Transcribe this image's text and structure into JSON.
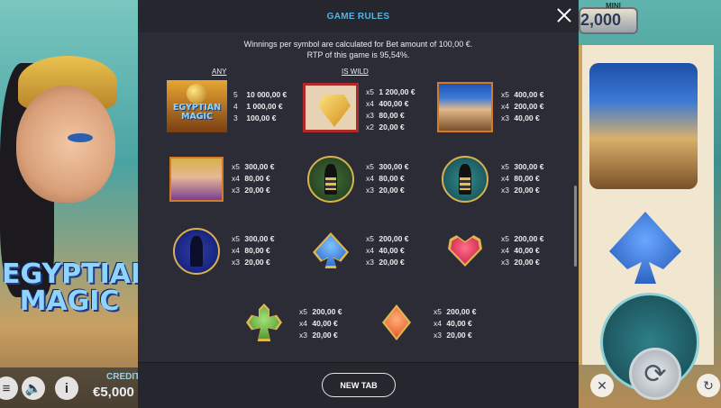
{
  "modal": {
    "title": "GAME RULES",
    "intro_line1": "Winnings per symbol are calculated for Bet amount of 100,00 €.",
    "intro_line2": "RTP of this game is 95,54%.",
    "col_any": "ANY",
    "col_wild": "IS WILD",
    "footer_button": "NEW TAB"
  },
  "symbols": [
    {
      "name": "egyptian-magic-logo",
      "label": "EGYPTIAN MAGIC",
      "pays": [
        {
          "m": "5",
          "v": "10 000,00 €"
        },
        {
          "m": "4",
          "v": "1 000,00 €"
        },
        {
          "m": "3",
          "v": "100,00 €"
        }
      ]
    },
    {
      "name": "wild-gem",
      "pays": [
        {
          "m": "x5",
          "v": "1 200,00 €"
        },
        {
          "m": "x4",
          "v": "400,00 €"
        },
        {
          "m": "x3",
          "v": "80,00 €"
        },
        {
          "m": "x2",
          "v": "20,00 €"
        }
      ]
    },
    {
      "name": "pharaoh",
      "pays": [
        {
          "m": "x5",
          "v": "400,00 €"
        },
        {
          "m": "x4",
          "v": "200,00 €"
        },
        {
          "m": "x3",
          "v": "40,00 €"
        }
      ]
    },
    {
      "name": "cleopatra",
      "pays": [
        {
          "m": "x5",
          "v": "300,00 €"
        },
        {
          "m": "x4",
          "v": "80,00 €"
        },
        {
          "m": "x3",
          "v": "20,00 €"
        }
      ]
    },
    {
      "name": "anubis-green",
      "pays": [
        {
          "m": "x5",
          "v": "300,00 €"
        },
        {
          "m": "x4",
          "v": "80,00 €"
        },
        {
          "m": "x3",
          "v": "20,00 €"
        }
      ]
    },
    {
      "name": "anubis-teal",
      "pays": [
        {
          "m": "x5",
          "v": "300,00 €"
        },
        {
          "m": "x4",
          "v": "80,00 €"
        },
        {
          "m": "x3",
          "v": "20,00 €"
        }
      ]
    },
    {
      "name": "bastet",
      "pays": [
        {
          "m": "x5",
          "v": "300,00 €"
        },
        {
          "m": "x4",
          "v": "80,00 €"
        },
        {
          "m": "x3",
          "v": "20,00 €"
        }
      ]
    },
    {
      "name": "spade",
      "pays": [
        {
          "m": "x5",
          "v": "200,00 €"
        },
        {
          "m": "x4",
          "v": "40,00 €"
        },
        {
          "m": "x3",
          "v": "20,00 €"
        }
      ]
    },
    {
      "name": "heart",
      "pays": [
        {
          "m": "x5",
          "v": "200,00 €"
        },
        {
          "m": "x4",
          "v": "40,00 €"
        },
        {
          "m": "x3",
          "v": "20,00 €"
        }
      ]
    },
    {
      "name": "club",
      "pays": [
        {
          "m": "x5",
          "v": "200,00 €"
        },
        {
          "m": "x4",
          "v": "40,00 €"
        },
        {
          "m": "x3",
          "v": "20,00 €"
        }
      ]
    },
    {
      "name": "diamond",
      "pays": [
        {
          "m": "x5",
          "v": "200,00 €"
        },
        {
          "m": "x4",
          "v": "40,00 €"
        },
        {
          "m": "x3",
          "v": "20,00 €"
        }
      ]
    }
  ],
  "background": {
    "logo_line1": "EGYPTIAN",
    "logo_line2": "MAGIC",
    "credit_label": "CREDIT",
    "credit_value": "€5,000",
    "mini_label": "MINI",
    "mini_value": "2,000"
  }
}
